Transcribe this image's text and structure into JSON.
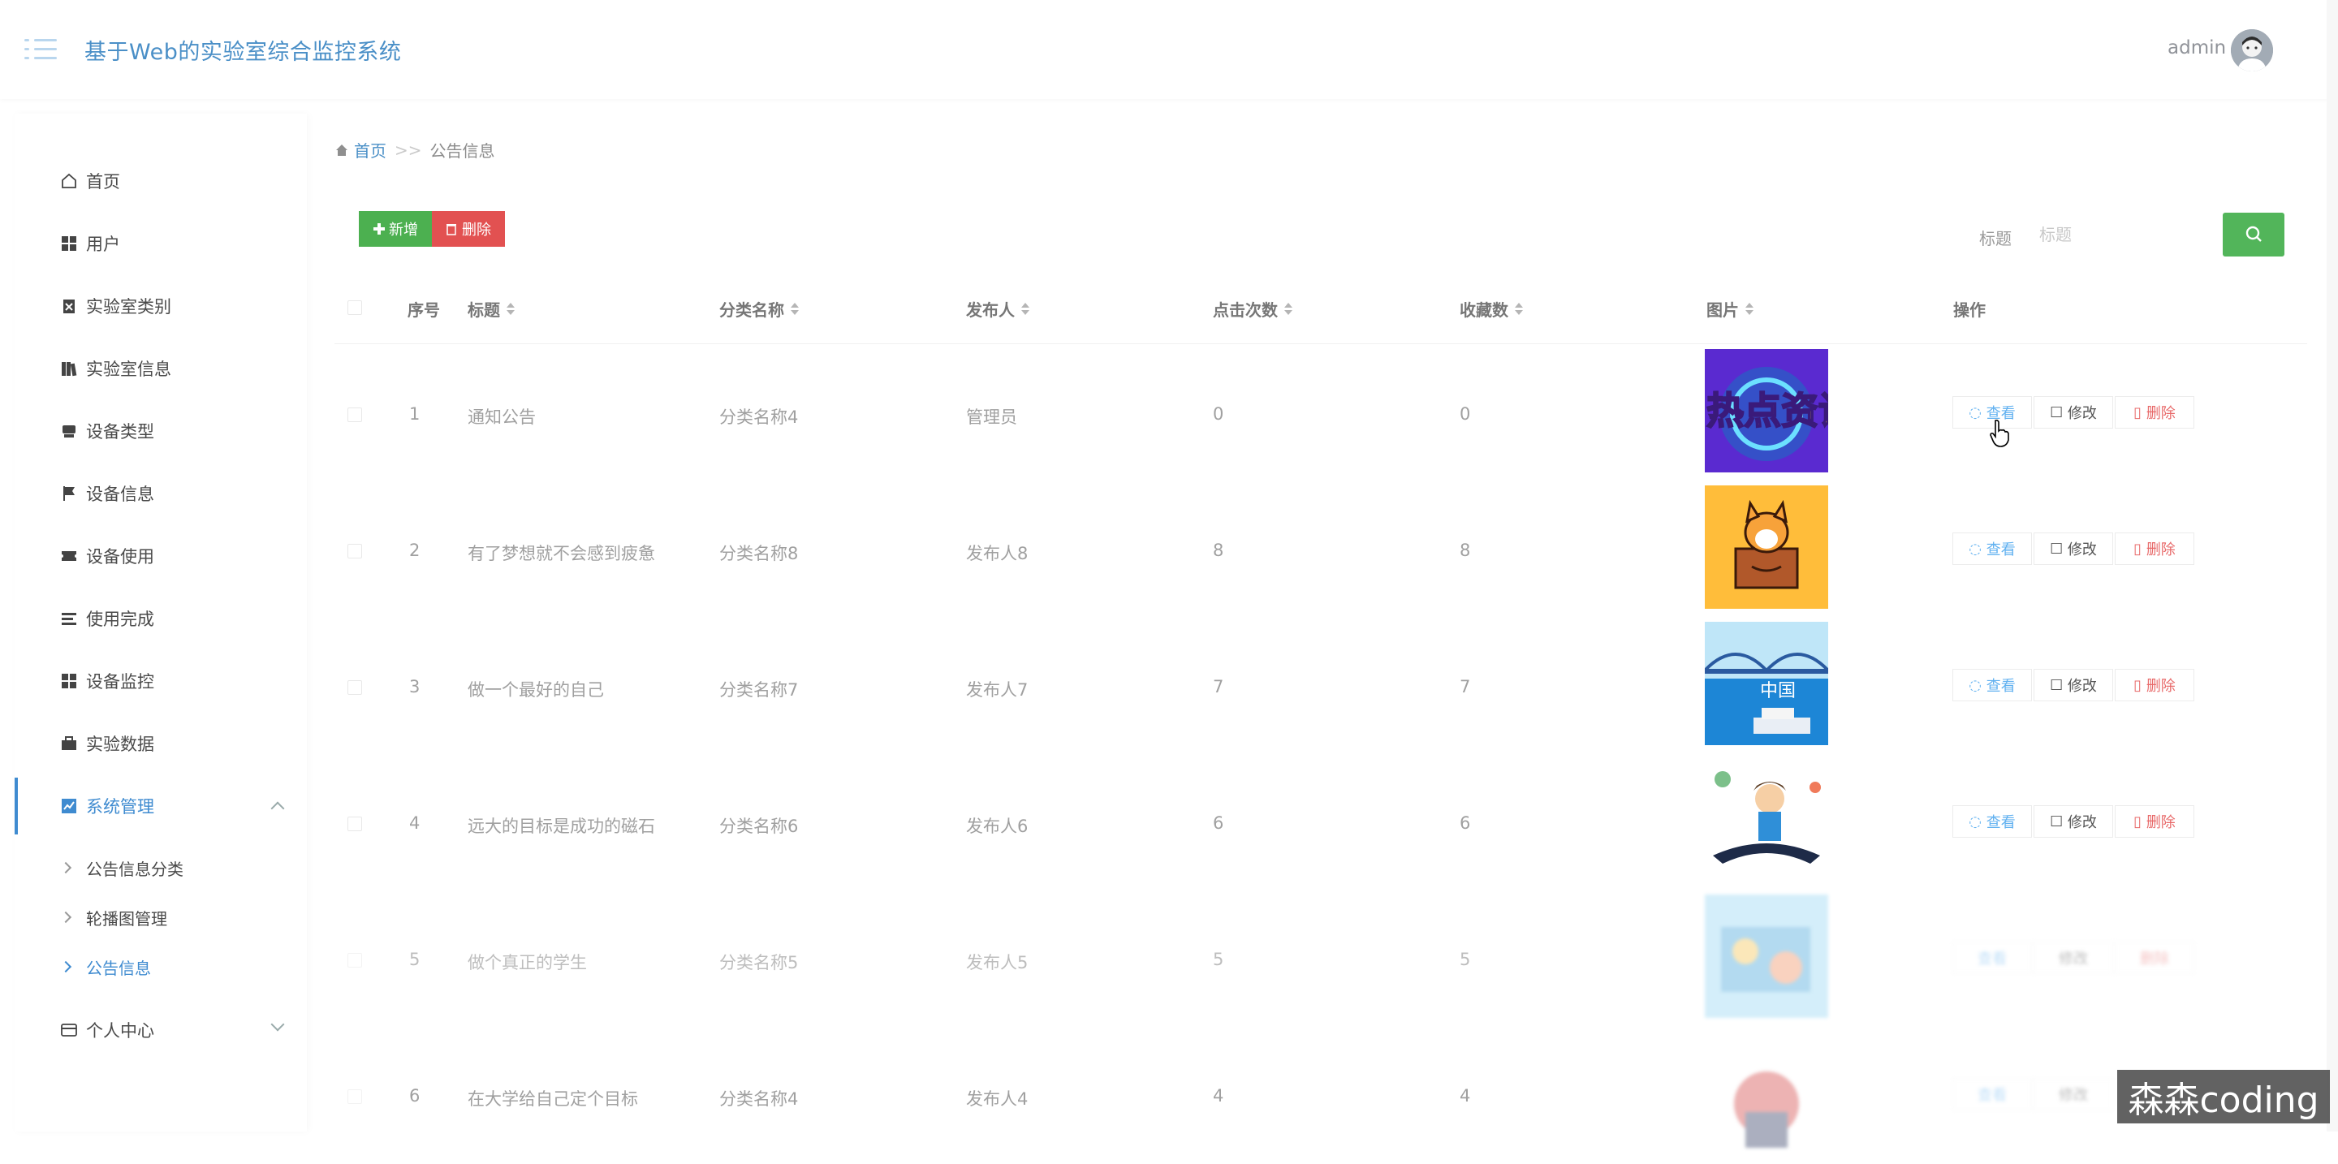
{
  "header": {
    "title": "基于Web的实验室综合监控系统",
    "user": "admin"
  },
  "sidebar": {
    "items": [
      {
        "label": "首页",
        "icon": "home-icon"
      },
      {
        "label": "用户",
        "icon": "grid-icon"
      },
      {
        "label": "实验室类别",
        "icon": "clipboard-icon"
      },
      {
        "label": "实验室信息",
        "icon": "book-icon"
      },
      {
        "label": "设备类型",
        "icon": "printer-icon"
      },
      {
        "label": "设备信息",
        "icon": "flag-icon"
      },
      {
        "label": "设备使用",
        "icon": "ticket-icon"
      },
      {
        "label": "使用完成",
        "icon": "list-icon"
      },
      {
        "label": "设备监控",
        "icon": "grid-icon"
      },
      {
        "label": "实验数据",
        "icon": "briefcase-icon"
      },
      {
        "label": "系统管理",
        "icon": "chart-icon"
      }
    ],
    "sub_items": [
      {
        "label": "公告信息分类"
      },
      {
        "label": "轮播图管理"
      },
      {
        "label": "公告信息"
      }
    ],
    "personal": {
      "label": "个人中心",
      "icon": "card-icon"
    }
  },
  "breadcrumb": {
    "home": "首页",
    "sep": ">>",
    "current": "公告信息"
  },
  "toolbar": {
    "add_label": "新增",
    "delete_label": "删除"
  },
  "filter": {
    "label": "标题",
    "placeholder": "标题",
    "value": ""
  },
  "table": {
    "headers": {
      "index": "序号",
      "title": "标题",
      "category": "分类名称",
      "publisher": "发布人",
      "clicks": "点击次数",
      "favorites": "收藏数",
      "image": "图片",
      "actions": "操作"
    },
    "rows": [
      {
        "index": "1",
        "title": "通知公告",
        "category": "分类名称4",
        "publisher": "管理员",
        "clicks": "0",
        "favorites": "0",
        "image_text": "热点资讯"
      },
      {
        "index": "2",
        "title": "有了梦想就不会感到疲惫",
        "category": "分类名称8",
        "publisher": "发布人8",
        "clicks": "8",
        "favorites": "8"
      },
      {
        "index": "3",
        "title": "做一个最好的自己",
        "category": "分类名称7",
        "publisher": "发布人7",
        "clicks": "7",
        "favorites": "7",
        "image_text": "中国"
      },
      {
        "index": "4",
        "title": "远大的目标是成功的磁石",
        "category": "分类名称6",
        "publisher": "发布人6",
        "clicks": "6",
        "favorites": "6"
      },
      {
        "index": "5",
        "title": "做个真正的学生",
        "category": "分类名称5",
        "publisher": "发布人5",
        "clicks": "5",
        "favorites": "5"
      },
      {
        "index": "6",
        "title": "在大学给自己定个目标",
        "category": "分类名称4",
        "publisher": "发布人4",
        "clicks": "4",
        "favorites": "4"
      }
    ],
    "actions": {
      "view": "查看",
      "edit": "修改",
      "delete": "删除"
    }
  },
  "watermark": "森森coding",
  "colors": {
    "primary": "#4a8fc7",
    "add": "#4cb050",
    "danger": "#e25151",
    "search": "#52b55a"
  }
}
